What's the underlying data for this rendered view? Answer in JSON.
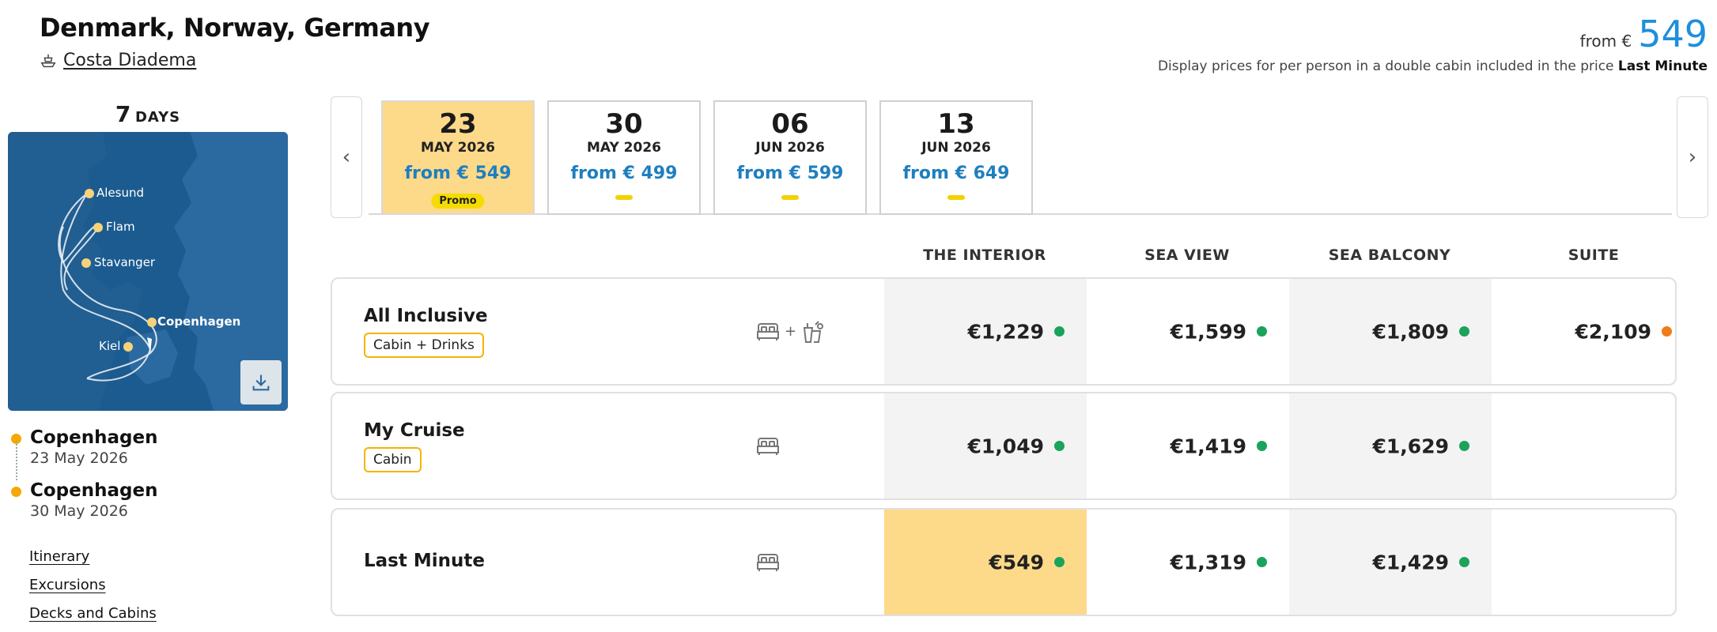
{
  "header": {
    "title": "Denmark, Norway, Germany",
    "ship_name": "Costa Diadema",
    "from_label": "from €",
    "from_value": "549",
    "display_note": "Display prices for per person in a double cabin included in the price",
    "display_note_bold": "Last Minute"
  },
  "sidebar": {
    "days_number": "7",
    "days_label": "DAYS",
    "map_ports": [
      "Alesund",
      "Flam",
      "Stavanger",
      "Copenhagen",
      "Kiel"
    ],
    "stops": [
      {
        "port": "Copenhagen",
        "date": "23 May 2026"
      },
      {
        "port": "Copenhagen",
        "date": "30 May 2026"
      }
    ],
    "links": [
      "Itinerary",
      "Excursions",
      "Decks and Cabins"
    ]
  },
  "carousel": {
    "prev_icon": "‹",
    "next_icon": "›",
    "dates": [
      {
        "day": "23",
        "month": "MAY 2026",
        "price": "from € 549",
        "tag": "Promo",
        "selected": true
      },
      {
        "day": "30",
        "month": "MAY 2026",
        "price": "from € 499",
        "tag": "",
        "selected": false
      },
      {
        "day": "06",
        "month": "JUN 2026",
        "price": "from € 599",
        "tag": "",
        "selected": false
      },
      {
        "day": "13",
        "month": "JUN 2026",
        "price": "from € 649",
        "tag": "",
        "selected": false
      }
    ]
  },
  "table": {
    "columns": [
      "THE INTERIOR",
      "SEA VIEW",
      "SEA BALCONY",
      "SUITE"
    ],
    "rows": [
      {
        "title": "All Inclusive",
        "badge": "Cabin + Drinks",
        "icons": [
          "bed-icon",
          "drinks-icon"
        ],
        "plus": "+",
        "prices": [
          "€1,229",
          "€1,599",
          "€1,809",
          "€2,109"
        ],
        "availability": [
          "#1aa35a",
          "#1aa35a",
          "#1aa35a",
          "#f07c1a"
        ]
      },
      {
        "title": "My Cruise",
        "badge": "Cabin",
        "icons": [
          "bed-icon"
        ],
        "prices": [
          "€1,049",
          "€1,419",
          "€1,629",
          ""
        ],
        "availability": [
          "#1aa35a",
          "#1aa35a",
          "#1aa35a",
          ""
        ]
      },
      {
        "title": "Last Minute",
        "badge": "",
        "icons": [
          "bed-icon"
        ],
        "prices": [
          "€549",
          "€1,319",
          "€1,429",
          ""
        ],
        "availability": [
          "#1aa35a",
          "#1aa35a",
          "#1aa35a",
          ""
        ]
      }
    ]
  },
  "colors": {
    "accent_blue": "#1e8fdc",
    "price_blue": "#1e7fbf",
    "selected_yellow": "#fdd98a",
    "badge_border": "#f5b400",
    "available_green": "#1aa35a",
    "limited_orange": "#f07c1a"
  }
}
